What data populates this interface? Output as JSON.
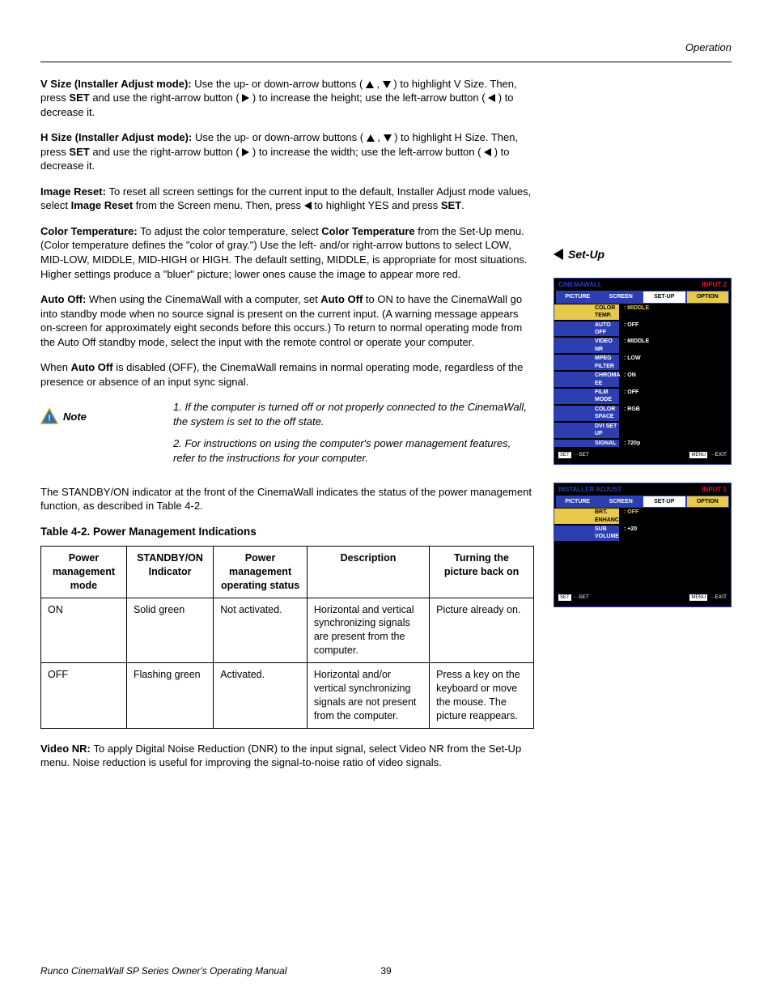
{
  "header": {
    "section": "Operation"
  },
  "paras": {
    "vsize_bold": "V Size (Installer Adjust mode): ",
    "vsize_t1": "Use the up- or down-arrow buttons ( ",
    "vsize_t2": " , ",
    "vsize_t3": " ) to highlight V Size. Then, press ",
    "vsize_set": "SET",
    "vsize_t4": " and use the right-arrow button ( ",
    "vsize_t5": " ) to increase the height; use the left-arrow button ( ",
    "vsize_t6": " ) to decrease it.",
    "hsize_bold": "H Size (Installer Adjust mode): ",
    "hsize_t1": "Use the up- or down-arrow buttons ( ",
    "hsize_t3": " ) to highlight H Size. Then, press ",
    "hsize_t4": " and use the right-arrow button ( ",
    "hsize_t5": " ) to increase the width; use the left-arrow button ( ",
    "hsize_t6": " ) to decrease it.",
    "imgr_bold": "Image Reset: ",
    "imgr_t1": "To reset all screen settings for the current input to the default, Installer Adjust mode values, select ",
    "imgr_b2": "Image Reset",
    "imgr_t2": " from the Screen menu. Then, press ",
    "imgr_t3": " to highlight YES and press ",
    "imgr_b3": "SET",
    "imgr_t4": ".",
    "ct_bold": "Color Temperature: ",
    "ct_t1": "To adjust the color temperature, select ",
    "ct_b2": "Color Temperature",
    "ct_t2": " from the Set-Up menu. (Color temperature defines the \"color of gray.\") Use the left- and/or right-arrow buttons to select LOW, MID-LOW, MIDDLE, MID-HIGH or HIGH. The default setting, MIDDLE, is appropriate for most situations. Higher settings produce a \"bluer\" picture; lower ones cause the image to appear more red.",
    "ao_bold": "Auto Off: ",
    "ao_t1": "When using the CinemaWall with a computer, set ",
    "ao_b2": "Auto Off",
    "ao_t2": " to ON to have the CinemaWall go into standby mode when no source signal is present on the current input. (A warning message appears on-screen for approximately eight seconds before this occurs.) To return to normal operating mode from the Auto Off standby mode, select the input with the remote control or operate your computer.",
    "ao2_t1": "When ",
    "ao2_b": "Auto Off",
    "ao2_t2": " is disabled (OFF), the CinemaWall remains in normal operating mode, regardless of the presence or absence of an input sync signal.",
    "note_label": "Note",
    "note_1": "1. If the computer is turned off or not properly connected to the CinemaWall, the system is set to the off state.",
    "note_2": "2. For instructions on using the computer's power management features, refer to the instructions for your computer.",
    "standby_t": "The STANDBY/ON indicator at the front of the CinemaWall indicates the status of the power management function, as described in Table 4-2.",
    "table_title": "Table 4-2. Power Management Indications",
    "vnr_bold": "Video NR: ",
    "vnr_t": "To apply Digital Noise Reduction (DNR) to the input signal, select Video NR from the Set-Up menu. Noise reduction is useful for improving the signal-to-noise ratio of video signals."
  },
  "table": {
    "headers": [
      "Power management mode",
      "STANDBY/ON Indicator",
      "Power management operating status",
      "Description",
      "Turning the picture back on"
    ],
    "rows": [
      [
        "ON",
        "Solid green",
        "Not activated.",
        "Horizontal and vertical synchronizing signals are present from the computer.",
        "Picture already on."
      ],
      [
        "OFF",
        "Flashing green",
        "Activated.",
        "Horizontal and/or vertical synchronizing signals are not present from the computer.",
        "Press a key on the keyboard or move the mouse. The picture reappears."
      ]
    ]
  },
  "side": {
    "heading": "Set-Up",
    "osd1": {
      "title": "CINEMAWALL",
      "input": "INPUT 2",
      "tabs": [
        "PICTURE",
        "SCREEN",
        "SET-UP",
        "OPTION"
      ],
      "active_tab": 2,
      "rows": [
        {
          "k": "COLOR TEMP.",
          "v": ": MIDDLE",
          "hl": true
        },
        {
          "k": "AUTO OFF",
          "v": ": OFF"
        },
        {
          "k": "VIDEO NR",
          "v": ": MIDDLE"
        },
        {
          "k": "MPEG FILTER",
          "v": ": LOW"
        },
        {
          "k": "CHROMA EE",
          "v": ": ON"
        },
        {
          "k": "FILM MODE",
          "v": ": OFF"
        },
        {
          "k": "COLOR SPACE",
          "v": ": RGB"
        },
        {
          "k": "DVI SET UP",
          "v": ""
        },
        {
          "k": "SIGNAL",
          "v": ": 720p"
        }
      ],
      "foot_l_pill": "SET",
      "foot_l": "···SET",
      "foot_r_pill": "MENU",
      "foot_r": "···EXIT"
    },
    "osd2": {
      "title": "INSTALLER ADJUST",
      "input": "INPUT 1",
      "tabs": [
        "PICTURE",
        "SCREEN",
        "SET-UP",
        "OPTION"
      ],
      "active_tab": 2,
      "rows": [
        {
          "k": "BRT. ENHANCE",
          "v": ": OFF",
          "hl": true
        },
        {
          "k": "SUB VOLUME",
          "v": ": +20"
        }
      ],
      "foot_l_pill": "SET",
      "foot_l": "···SET",
      "foot_r_pill": "MENU",
      "foot_r": "···EXIT"
    }
  },
  "footer": {
    "left": "Runco CinemaWall SP Series Owner's Operating Manual",
    "page": "39"
  }
}
